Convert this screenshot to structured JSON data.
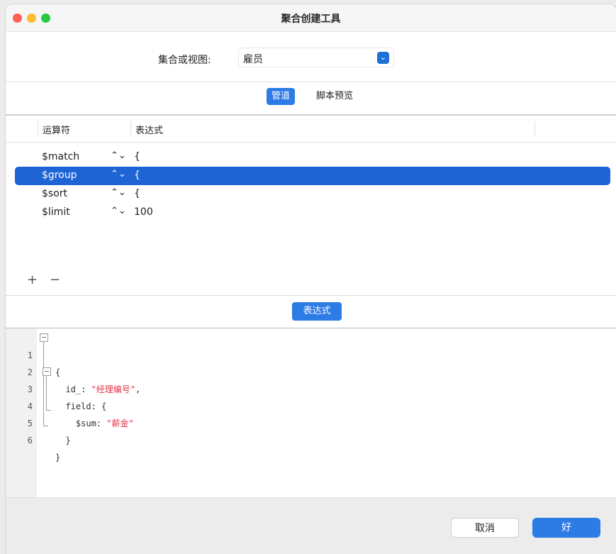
{
  "window": {
    "title": "聚合创建工具"
  },
  "collection": {
    "label": "集合或视图:",
    "value": "雇员"
  },
  "tabs": {
    "pipeline": "管道",
    "script_preview": "脚本预览"
  },
  "table": {
    "headers": {
      "operator": "运算符",
      "expression": "表达式"
    },
    "rows": [
      {
        "operator": "$match",
        "expression": "{"
      },
      {
        "operator": "$group",
        "expression": "{"
      },
      {
        "operator": "$sort",
        "expression": "{"
      },
      {
        "operator": "$limit",
        "expression": "100"
      }
    ],
    "stepper_glyph": "⌃⌄",
    "add_glyph": "+",
    "remove_glyph": "−"
  },
  "expression_label": "表达式",
  "editor": {
    "line_numbers": [
      "1",
      "2",
      "3",
      "4",
      "5",
      "6"
    ],
    "lines": [
      {
        "pre": "{",
        "str": "",
        "post": ""
      },
      {
        "pre": "  id_: ",
        "str": "\"经理编号\"",
        "post": ","
      },
      {
        "pre": "  field: {",
        "str": "",
        "post": ""
      },
      {
        "pre": "    $sum: ",
        "str": "\"薪金\"",
        "post": ""
      },
      {
        "pre": "  }",
        "str": "",
        "post": ""
      },
      {
        "pre": "}",
        "str": "",
        "post": ""
      }
    ]
  },
  "footer": {
    "cancel": "取消",
    "ok": "好"
  },
  "colors": {
    "accent": "#2d7be5",
    "selection": "#1f64d4",
    "string": "#e0364c"
  }
}
